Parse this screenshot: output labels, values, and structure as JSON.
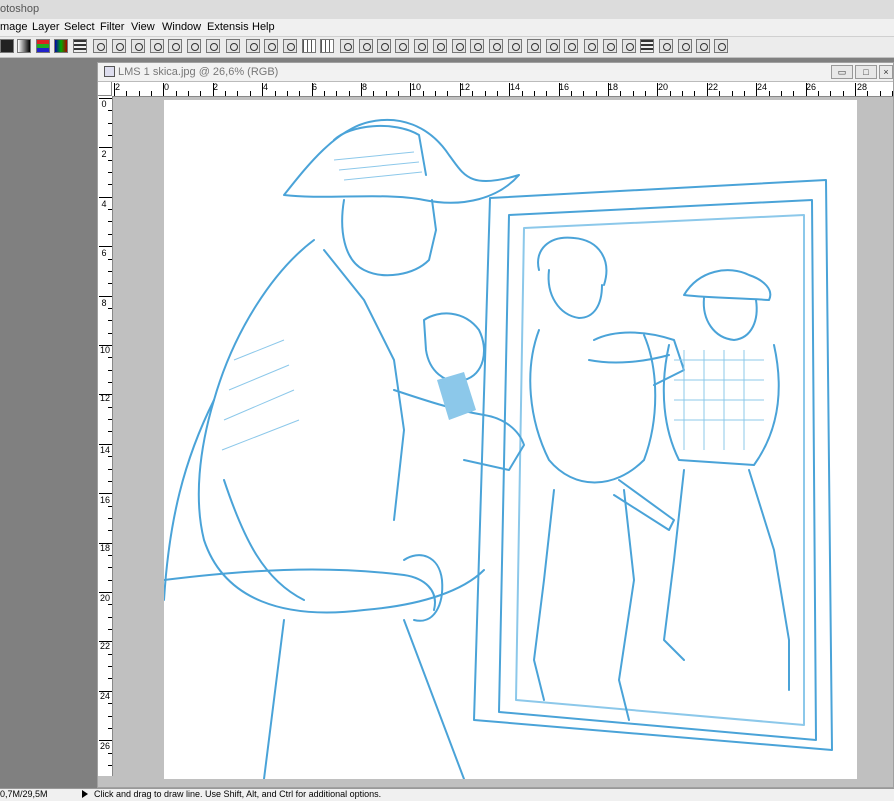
{
  "app": {
    "title_partial": "otoshop"
  },
  "menu": [
    "mage",
    "Layer",
    "Select",
    "Filter",
    "View",
    "Window",
    "Extensis",
    "Help"
  ],
  "document": {
    "title": "LMS 1 skica.jpg @ 26,6% (RGB)",
    "buttons": {
      "minimize": "▭",
      "maximize": "□",
      "close": "×"
    }
  },
  "rulers": {
    "horizontal": [
      "2",
      "0",
      "2",
      "4",
      "6",
      "8",
      "10",
      "12",
      "14",
      "16",
      "18",
      "20",
      "22",
      "24",
      "26",
      "28"
    ],
    "vertical": [
      "0",
      "2",
      "4",
      "6",
      "8",
      "10",
      "12",
      "14",
      "16",
      "18",
      "20",
      "22",
      "24",
      "26"
    ]
  },
  "toolbar": {
    "icons": [
      "black-swatch-icon",
      "gradient-swatch-icon",
      "rgb-channels-icon",
      "gradient-map-icon",
      "levels-icon",
      "line-tool-icon",
      "magic-wand-icon",
      "crop-icon",
      "transform-icon",
      "burn-icon",
      "marquee-icon",
      "measure-icon",
      "path-select-icon",
      "zoom-in-icon",
      "zoom-out-icon",
      "zoom-icon",
      "grid-icon",
      "rotate-icon",
      "lasso-icon",
      "pen-icon",
      "channel-icon",
      "crop-tool-icon",
      "lasso-all-icon",
      "lasso-poly-icon",
      "lasso-mag-icon",
      "brush-icon",
      "transform-box-icon",
      "transform-box-2-icon",
      "stamp-icon",
      "stack-icon",
      "stack-2-icon",
      "stack-3-icon",
      "hatch-icon",
      "eraser-icon",
      "drop-icon",
      "layers-icon",
      "rec-icon"
    ]
  },
  "status": {
    "memory": "0,7M/29,5M",
    "hint": "Click and drag to draw line.  Use Shift, Alt, and Ctrl for additional options."
  },
  "colors": {
    "sketch": "#4aa3d8",
    "sketch_light": "#8cc8ea",
    "workspace": "#808080"
  }
}
